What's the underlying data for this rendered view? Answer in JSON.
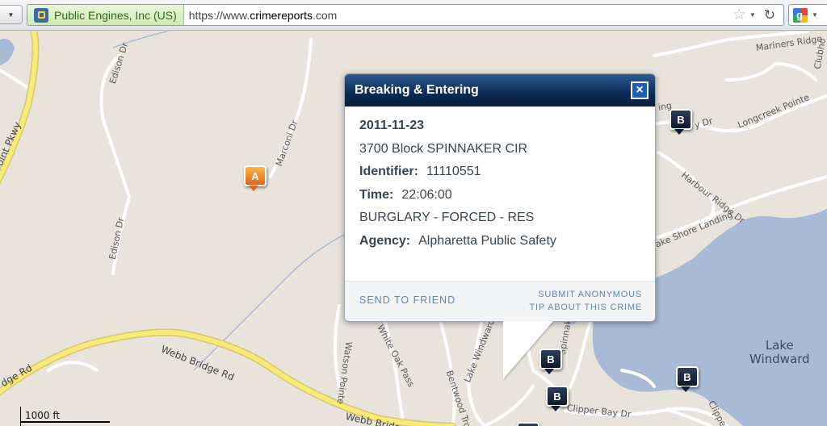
{
  "browser": {
    "identity": "Public Engines, Inc (US)",
    "url_prefix": "https://www.",
    "url_domain": "crimereports",
    "url_suffix": ".com"
  },
  "map": {
    "streets": {
      "edison_dr_top": "Edison Dr",
      "edison_dr_mid": "Edison Dr",
      "marconi_dr": "Marconi Dr",
      "point_pkwy": "Point Pkwy",
      "mariners_ridge": "Mariners Ridge",
      "clubhouse": "Clubho",
      "longcreek_pointe": "Longcreek Pointe",
      "ldr_fragment": "y Dr",
      "lnd_fragment": "ing",
      "harbour_ridge_dr": "Harbour Ridge Dr",
      "lake_shore_landing": "ake Shore Landing",
      "webb_bridge_rd_left": "Webb Bridge Rd",
      "webb_bridge_rd_bottom": "Webb Bridge Rd",
      "ridge_rd": "dge Rd",
      "white_oak_pass": "White Oak Pass",
      "watson_pointe": "Watson Pointe",
      "bentwood_trce": "Bentwood Trce",
      "lake_windward_dr": "Lake Windward Dr",
      "spinnaker_ln": "Spinnaker Ln",
      "clipper_bay_dr": "Clipper Bay Dr",
      "clippe": "Clippe",
      "w_fragment": "W"
    },
    "lake_name": "Lake\nWindward",
    "scale": "1000 ft",
    "markers": {
      "a1": "A",
      "b1": "B",
      "b2": "B",
      "b3": "B",
      "b4": "B"
    }
  },
  "popup": {
    "title": "Breaking & Entering",
    "close": "×",
    "date": "2011-11-23",
    "address": "3700 Block SPINNAKER CIR",
    "identifier_label": "Identifier:",
    "identifier": "11110551",
    "time_label": "Time:",
    "time": "22:06:00",
    "offense": "BURGLARY - FORCED - RES",
    "agency_label": "Agency:",
    "agency": "Alpharetta Public Safety",
    "send_to_friend": "SEND TO FRIEND",
    "submit_tip": "SUBMIT ANONYMOUS\nTIP ABOUT THIS CRIME"
  },
  "colors": {
    "header_dark": "#0b2a52",
    "link": "#5d86b3",
    "highway": "#f7eb7a",
    "water": "#a7bbd6"
  }
}
